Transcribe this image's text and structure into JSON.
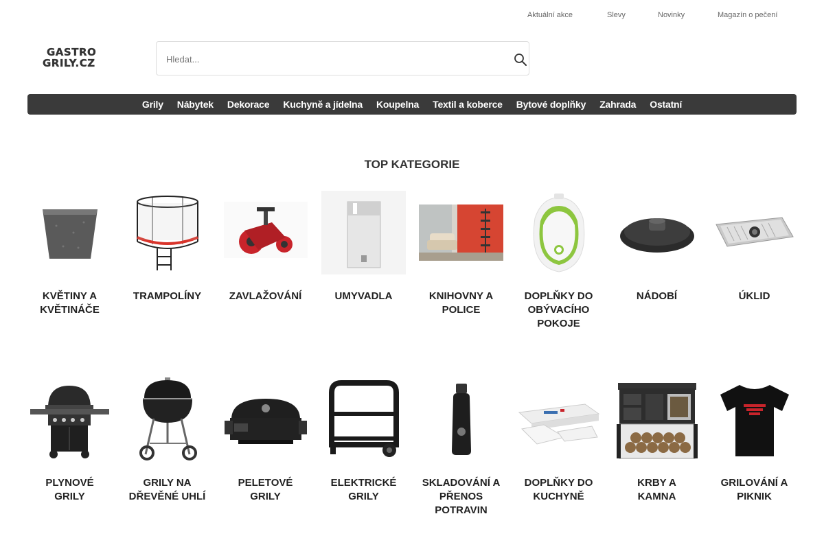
{
  "top_links": [
    {
      "label": "Aktuální akce"
    },
    {
      "label": "Slevy"
    },
    {
      "label": "Novinky"
    },
    {
      "label": "Magazín o pečení"
    }
  ],
  "logo": {
    "line1": "GASTRO",
    "line2": "GRILY.CZ"
  },
  "search": {
    "placeholder": "Hledat...",
    "value": ""
  },
  "nav": [
    {
      "label": "Grily"
    },
    {
      "label": "Nábytek"
    },
    {
      "label": "Dekorace"
    },
    {
      "label": "Kuchyně a jídelna"
    },
    {
      "label": "Koupelna"
    },
    {
      "label": "Textil a koberce"
    },
    {
      "label": "Bytové doplňky"
    },
    {
      "label": "Zahrada"
    },
    {
      "label": "Ostatní"
    }
  ],
  "section_title": "TOP KATEGORIE",
  "categories_row1": [
    {
      "label": "KVĚTINY A KVĚTINÁČE",
      "icon": "planter-icon"
    },
    {
      "label": "TRAMPOLÍNY",
      "icon": "trampoline-icon"
    },
    {
      "label": "ZAVLAŽOVÁNÍ",
      "icon": "sprinkler-icon"
    },
    {
      "label": "UMYVADLA",
      "icon": "sink-icon"
    },
    {
      "label": "KNIHOVNY A POLICE",
      "icon": "bookshelf-icon"
    },
    {
      "label": "DOPLŇKY DO OBÝVACÍHO POKOJE",
      "icon": "humidifier-icon"
    },
    {
      "label": "NÁDOBÍ",
      "icon": "pot-lid-icon"
    },
    {
      "label": "ÚKLID",
      "icon": "drip-tray-icon"
    }
  ],
  "categories_row2": [
    {
      "label": "PLYNOVÉ GRILY",
      "icon": "gas-grill-icon"
    },
    {
      "label": "GRILY NA DŘEVĚNÉ UHLÍ",
      "icon": "kettle-grill-icon"
    },
    {
      "label": "PELETOVÉ GRILY",
      "icon": "pellet-grill-icon"
    },
    {
      "label": "ELEKTRICKÉ GRILY",
      "icon": "grill-cart-icon"
    },
    {
      "label": "SKLADOVÁNÍ A PŘENOS POTRAVIN",
      "icon": "bottle-icon"
    },
    {
      "label": "DOPLŇKY DO KUCHYNĚ",
      "icon": "vacuum-sealer-icon"
    },
    {
      "label": "KRBY A KAMNA",
      "icon": "wood-stove-icon"
    },
    {
      "label": "GRILOVÁNÍ A PIKNIK",
      "icon": "tshirt-icon"
    }
  ],
  "colors": {
    "nav_bg": "#3a3a3a",
    "accent_green": "#8dc63f",
    "accent_red": "#c8242b"
  }
}
